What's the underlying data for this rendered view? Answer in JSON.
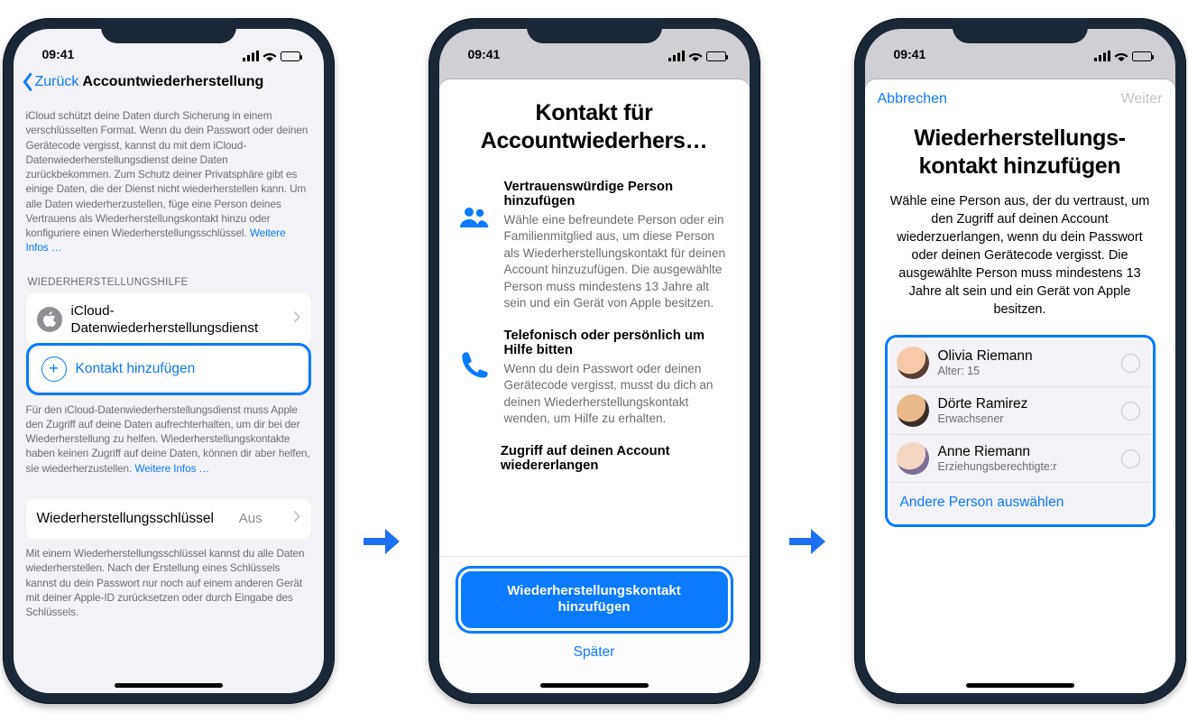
{
  "status_time": "09:41",
  "screen1": {
    "back": "Zurück",
    "title": "Accountwiederherstellung",
    "intro": "iCloud schützt deine Daten durch Sicherung in einem verschlüsselten Format. Wenn du dein Passwort oder deinen Gerätecode vergisst, kannst du mit dem iCloud-Datenwiederherstellungsdienst deine Daten zurückbekommen. Zum Schutz deiner Privatsphäre gibt es einige Daten, die der Dienst nicht wiederherstellen kann. Um alle Daten wiederherzustellen, füge eine Person deines Vertrauens als Wiederherstellungskontakt hinzu oder konfiguriere einen Wiederherstellungsschlüssel.",
    "intro_link": "Weitere Infos …",
    "group_hdr": "WIEDERHERSTELLUNGSHILFE",
    "cell_icloud": "iCloud-Datenwiederherstellungsdienst",
    "cell_add": "Kontakt hinzufügen",
    "desc2": "Für den iCloud-Datenwiederherstellungsdienst muss Apple den Zugriff auf deine Daten aufrechterhalten, um dir bei der Wiederherstellung zu helfen. Wiederherstellungskontakte haben keinen Zugriff auf deine Daten, können dir aber helfen, sie wiederherzustellen.",
    "desc2_link": "Weitere Infos …",
    "key_label": "Wiederherstellungsschlüssel",
    "key_value": "Aus",
    "desc3": "Mit einem Wiederherstellungsschlüssel kannst du alle Daten wiederherstellen. Nach der Erstellung eines Schlüssels kannst du dein Passwort nur noch auf einem anderen Gerät mit deiner Apple-ID zurücksetzen oder durch Eingabe des Schlüssels."
  },
  "screen2": {
    "title_l1": "Kontakt für",
    "title_l2": "Accountwiederhers…",
    "f1_t": "Vertrauenswürdige Person hinzufügen",
    "f1_b": "Wähle eine befreundete Person oder ein Familienmitglied aus, um diese Person als Wiederherstellungskontakt für deinen Account hinzuzufügen. Die ausgewählte Person muss mindestens 13 Jahre alt sein und ein Gerät von Apple besitzen.",
    "f2_t": "Telefonisch oder persönlich um Hilfe bitten",
    "f2_b": "Wenn du dein Passwort oder deinen Gerätecode vergisst, musst du dich an deinen Wiederherstellungskontakt wenden, um Hilfe zu erhalten.",
    "f3_t": "Zugriff auf deinen Account wiedererlangen",
    "primary_btn_l1": "Wiederherstellungskontakt",
    "primary_btn_l2": "hinzufügen",
    "later": "Später"
  },
  "screen3": {
    "cancel": "Abbrechen",
    "next": "Weiter",
    "title_l1": "Wiederherstellungs-",
    "title_l2": "kontakt hinzufügen",
    "sub": "Wähle eine Person aus, der du vertraust, um den Zugriff auf deinen Account wiederzuerlangen, wenn du dein Passwort oder deinen Gerätecode vergisst. Die ausgewählte Person muss mindestens 13 Jahre alt sein und ein Gerät von Apple besitzen.",
    "people": [
      {
        "name": "Olivia Riemann",
        "sub": "Alter: 15"
      },
      {
        "name": "Dörte Ramirez",
        "sub": "Erwachsener"
      },
      {
        "name": "Anne Riemann",
        "sub": "Erziehungsberechtigte:r"
      }
    ],
    "other": "Andere Person auswählen"
  }
}
